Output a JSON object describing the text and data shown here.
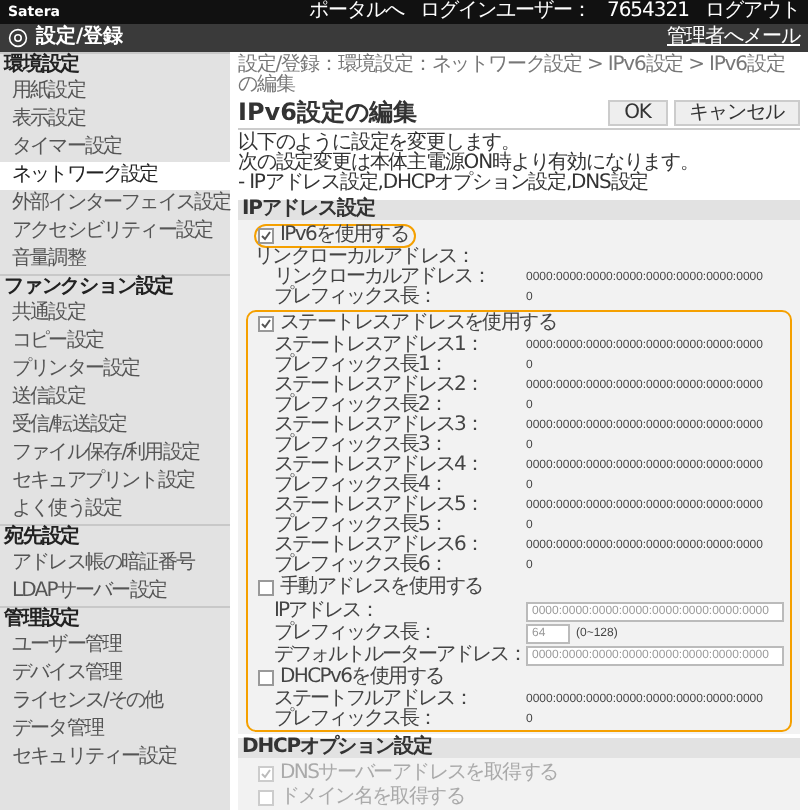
{
  "top_bar": {
    "brand": "Satera",
    "links": [
      "ポータルへ",
      "ログインユーザー：",
      "7654321",
      "ログアウト"
    ]
  },
  "header": {
    "title": "設定/登録",
    "mail_link": "管理者へメール"
  },
  "sidebar": [
    {
      "kind": "section",
      "label": "環境設定"
    },
    {
      "kind": "item",
      "label": "用紙設定",
      "selected": false
    },
    {
      "kind": "item",
      "label": "表示設定",
      "selected": false
    },
    {
      "kind": "item",
      "label": "タイマー設定",
      "selected": false
    },
    {
      "kind": "item",
      "label": "ネットワーク設定",
      "selected": true
    },
    {
      "kind": "item",
      "label": "外部インターフェイス設定",
      "selected": false
    },
    {
      "kind": "item",
      "label": "アクセシビリティー設定",
      "selected": false
    },
    {
      "kind": "item",
      "label": "音量調整",
      "selected": false
    },
    {
      "kind": "section",
      "label": "ファンクション設定"
    },
    {
      "kind": "item",
      "label": "共通設定",
      "selected": false
    },
    {
      "kind": "item",
      "label": "コピー設定",
      "selected": false
    },
    {
      "kind": "item",
      "label": "プリンター設定",
      "selected": false
    },
    {
      "kind": "item",
      "label": "送信設定",
      "selected": false
    },
    {
      "kind": "item",
      "label": "受信/転送設定",
      "selected": false
    },
    {
      "kind": "item",
      "label": "ファイル保存/利用設定",
      "selected": false
    },
    {
      "kind": "item",
      "label": "セキュアプリント設定",
      "selected": false
    },
    {
      "kind": "item",
      "label": "よく使う設定",
      "selected": false
    },
    {
      "kind": "section",
      "label": "宛先設定"
    },
    {
      "kind": "item",
      "label": "アドレス帳の暗証番号",
      "selected": false
    },
    {
      "kind": "item",
      "label": "LDAPサーバー設定",
      "selected": false
    },
    {
      "kind": "section",
      "label": "管理設定"
    },
    {
      "kind": "item",
      "label": "ユーザー管理",
      "selected": false
    },
    {
      "kind": "item",
      "label": "デバイス管理",
      "selected": false
    },
    {
      "kind": "item",
      "label": "ライセンス/その他",
      "selected": false
    },
    {
      "kind": "item",
      "label": "データ管理",
      "selected": false
    },
    {
      "kind": "item",
      "label": "セキュリティー設定",
      "selected": false
    }
  ],
  "breadcrumb": "設定/登録：環境設定：ネットワーク設定 > IPv6設定 > IPv6設定の編集",
  "page_title": "IPv6設定の編集",
  "buttons": [
    "OK",
    "キャンセル"
  ],
  "description": [
    "以下のように設定を変更します。",
    "次の設定変更は本体主電源ON時より有効になります。",
    "- IPアドレス設定,DHCPオプション設定,DNS設定"
  ],
  "sections": [
    {
      "title": "IPアドレス設定",
      "blocks": [
        {
          "highlighted": false,
          "rows": [
            {
              "kind": "checkbox",
              "label": "IPv6を使用する",
              "checked": true,
              "disabled": false,
              "highlighted": true
            },
            {
              "kind": "caption",
              "label": "リンクローカルアドレス："
            },
            {
              "kind": "pair",
              "label": "リンクローカルアドレス：",
              "value": "0000:0000:0000:0000:0000:0000:0000:0000"
            },
            {
              "kind": "pair",
              "label": "プレフィックス長：",
              "value": "0"
            }
          ]
        },
        {
          "highlighted": true,
          "rows": [
            {
              "kind": "checkbox",
              "label": "ステートレスアドレスを使用する",
              "checked": true,
              "disabled": false,
              "highlighted": false
            },
            {
              "kind": "pair",
              "label": "ステートレスアドレス1：",
              "value": "0000:0000:0000:0000:0000:0000:0000:0000"
            },
            {
              "kind": "pair",
              "label": "プレフィックス長1：",
              "value": "0"
            },
            {
              "kind": "pair",
              "label": "ステートレスアドレス2：",
              "value": "0000:0000:0000:0000:0000:0000:0000:0000"
            },
            {
              "kind": "pair",
              "label": "プレフィックス長2：",
              "value": "0"
            },
            {
              "kind": "pair",
              "label": "ステートレスアドレス3：",
              "value": "0000:0000:0000:0000:0000:0000:0000:0000"
            },
            {
              "kind": "pair",
              "label": "プレフィックス長3：",
              "value": "0"
            },
            {
              "kind": "pair",
              "label": "ステートレスアドレス4：",
              "value": "0000:0000:0000:0000:0000:0000:0000:0000"
            },
            {
              "kind": "pair",
              "label": "プレフィックス長4：",
              "value": "0"
            },
            {
              "kind": "pair",
              "label": "ステートレスアドレス5：",
              "value": "0000:0000:0000:0000:0000:0000:0000:0000"
            },
            {
              "kind": "pair",
              "label": "プレフィックス長5：",
              "value": "0"
            },
            {
              "kind": "pair",
              "label": "ステートレスアドレス6：",
              "value": "0000:0000:0000:0000:0000:0000:0000:0000"
            },
            {
              "kind": "pair",
              "label": "プレフィックス長6：",
              "value": "0"
            },
            {
              "kind": "checkbox",
              "label": "手動アドレスを使用する",
              "checked": false,
              "disabled": false,
              "highlighted": false
            },
            {
              "kind": "field",
              "label": "IPアドレス：",
              "value": "0000:0000:0000:0000:0000:0000:0000:0000",
              "disabled": true
            },
            {
              "kind": "field",
              "label": "プレフィックス長：",
              "value": "64",
              "suffix": "(0~128)",
              "disabled": true
            },
            {
              "kind": "field",
              "label": "デフォルトルーターアドレス：",
              "value": "0000:0000:0000:0000:0000:0000:0000:0000",
              "disabled": true
            },
            {
              "kind": "checkbox",
              "label": "DHCPv6を使用する",
              "checked": false,
              "disabled": false,
              "highlighted": false
            },
            {
              "kind": "pair",
              "label": "ステートフルアドレス：",
              "value": "0000:0000:0000:0000:0000:0000:0000:0000"
            },
            {
              "kind": "pair",
              "label": "プレフィックス長：",
              "value": "0"
            }
          ]
        }
      ]
    },
    {
      "title": "DHCPオプション設定",
      "blocks": [
        {
          "highlighted": false,
          "rows": [
            {
              "kind": "checkbox",
              "label": "DNSサーバーアドレスを取得する",
              "checked": true,
              "disabled": true,
              "highlighted": false
            },
            {
              "kind": "checkbox",
              "label": "ドメイン名を取得する",
              "checked": false,
              "disabled": true,
              "highlighted": false
            }
          ]
        }
      ]
    }
  ]
}
